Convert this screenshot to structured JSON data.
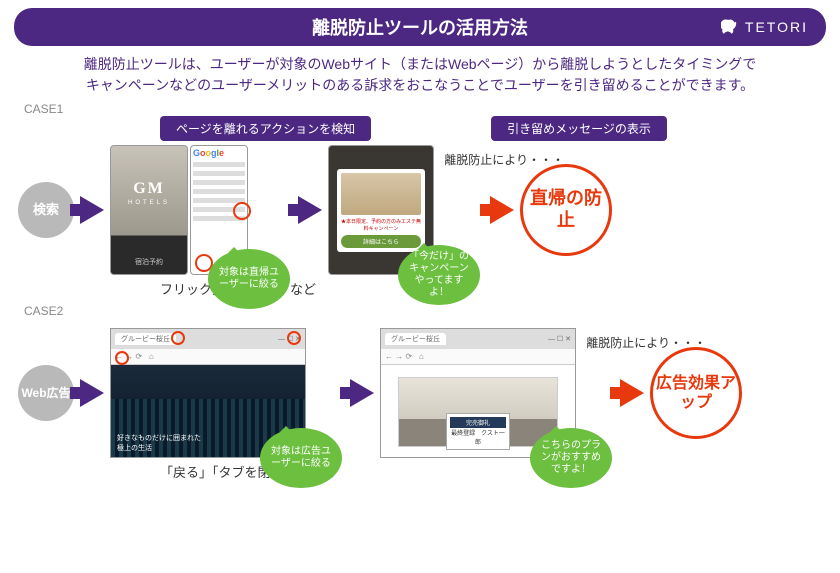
{
  "brand": "TETORI",
  "header": {
    "title": "離脱防止ツールの活用方法"
  },
  "intro": {
    "l1": "離脱防止ツールは、ユーザーが対象のWebサイト（またはWebページ）から離脱しようとしたタイミングで",
    "l2": "キャンペーンなどのユーザーメリットのある訴求をおこなうことでユーザーを引き留めることができます。"
  },
  "case1": {
    "label": "CASE1",
    "step1": "ページを離れるアクションを検知",
    "step2": "引き留めメッセージの表示",
    "circle": "検索",
    "caption": "フリック操作「戻る」など",
    "bubble1": "対象は直帰ユーザーに絞る",
    "bubble2": "「今だけ」のキャンペーンやってますよ！",
    "lead": "離脱防止により・・・",
    "result": "直帰の防止",
    "phone_logo": "GM",
    "phone_sub": "HOTELS",
    "phone_bar": "宿泊予約",
    "popup_red": "★本日限定、予約の方のみエステ無料キャンペーン",
    "popup_btn": "詳細はこちら"
  },
  "case2": {
    "label": "CASE2",
    "circle": "Web広告",
    "caption": "「戻る」「タブを閉じる」など",
    "bubble1": "対象は広告ユーザーに絞る",
    "bubble2": "こちらのプランがおすすめですよ！",
    "lead": "離脱防止により・・・",
    "result": "広告効果アップ",
    "tabname": "グルービー桜丘",
    "hero_txt1": "好きなものだけに囲まれた",
    "hero_txt2": "極上の生活",
    "overlay_hd": "完売御礼",
    "overlay_body": "最終登録　クスト一郎"
  }
}
